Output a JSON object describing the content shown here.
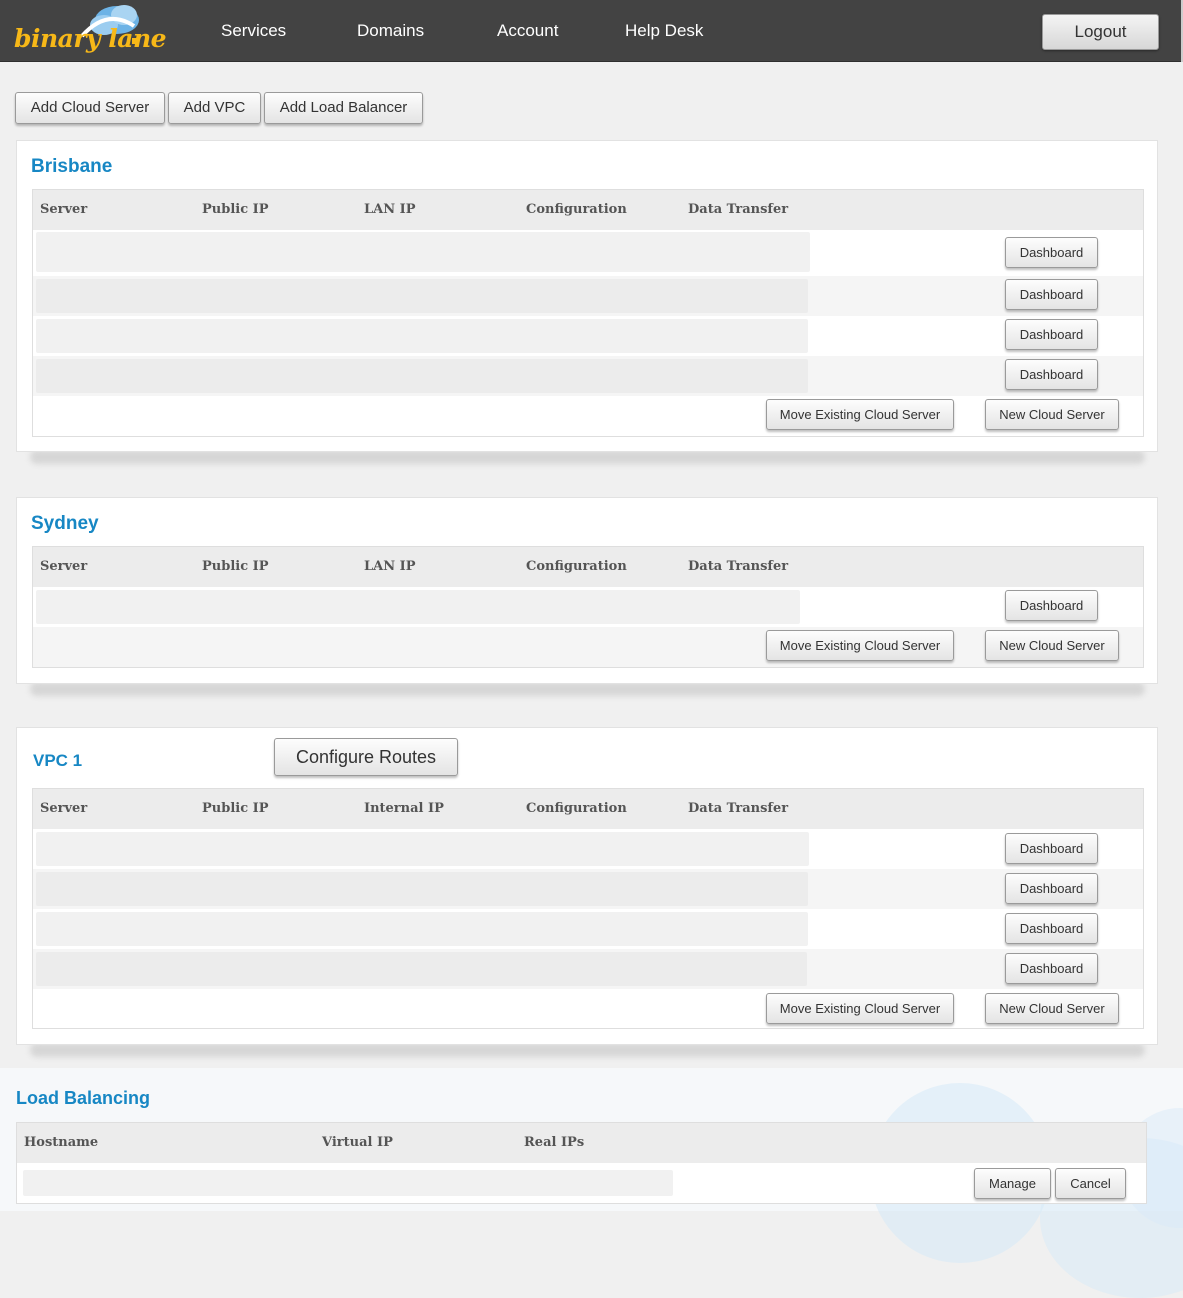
{
  "brand": {
    "logo_text": "binary lane"
  },
  "nav": {
    "items": [
      "Services",
      "Domains",
      "Account",
      "Help Desk"
    ],
    "logout_label": "Logout"
  },
  "toolbar": {
    "add_cloud_server": "Add Cloud Server",
    "add_vpc": "Add VPC",
    "add_load_balancer": "Add Load Balancer"
  },
  "table_headers": {
    "server": "Server",
    "public_ip": "Public IP",
    "lan_ip": "LAN IP",
    "internal_ip": "Internal IP",
    "configuration": "Configuration",
    "data_transfer": "Data Transfer"
  },
  "buttons": {
    "dashboard": "Dashboard",
    "move_existing": "Move Existing Cloud Server",
    "new_cloud_server": "New Cloud Server",
    "configure_routes": "Configure Routes",
    "manage": "Manage",
    "cancel": "Cancel"
  },
  "sections": {
    "brisbane": {
      "title": "Brisbane",
      "server_count": 4
    },
    "sydney": {
      "title": "Sydney",
      "server_count": 1
    },
    "vpc1": {
      "title": "VPC 1",
      "server_count": 4
    }
  },
  "load_balancing": {
    "title": "Load Balancing",
    "headers": {
      "hostname": "Hostname",
      "virtual_ip": "Virtual IP",
      "real_ips": "Real IPs"
    }
  },
  "colors": {
    "accent": "#1787c4",
    "header_bg": "#434343",
    "logo": "#f7b818"
  }
}
